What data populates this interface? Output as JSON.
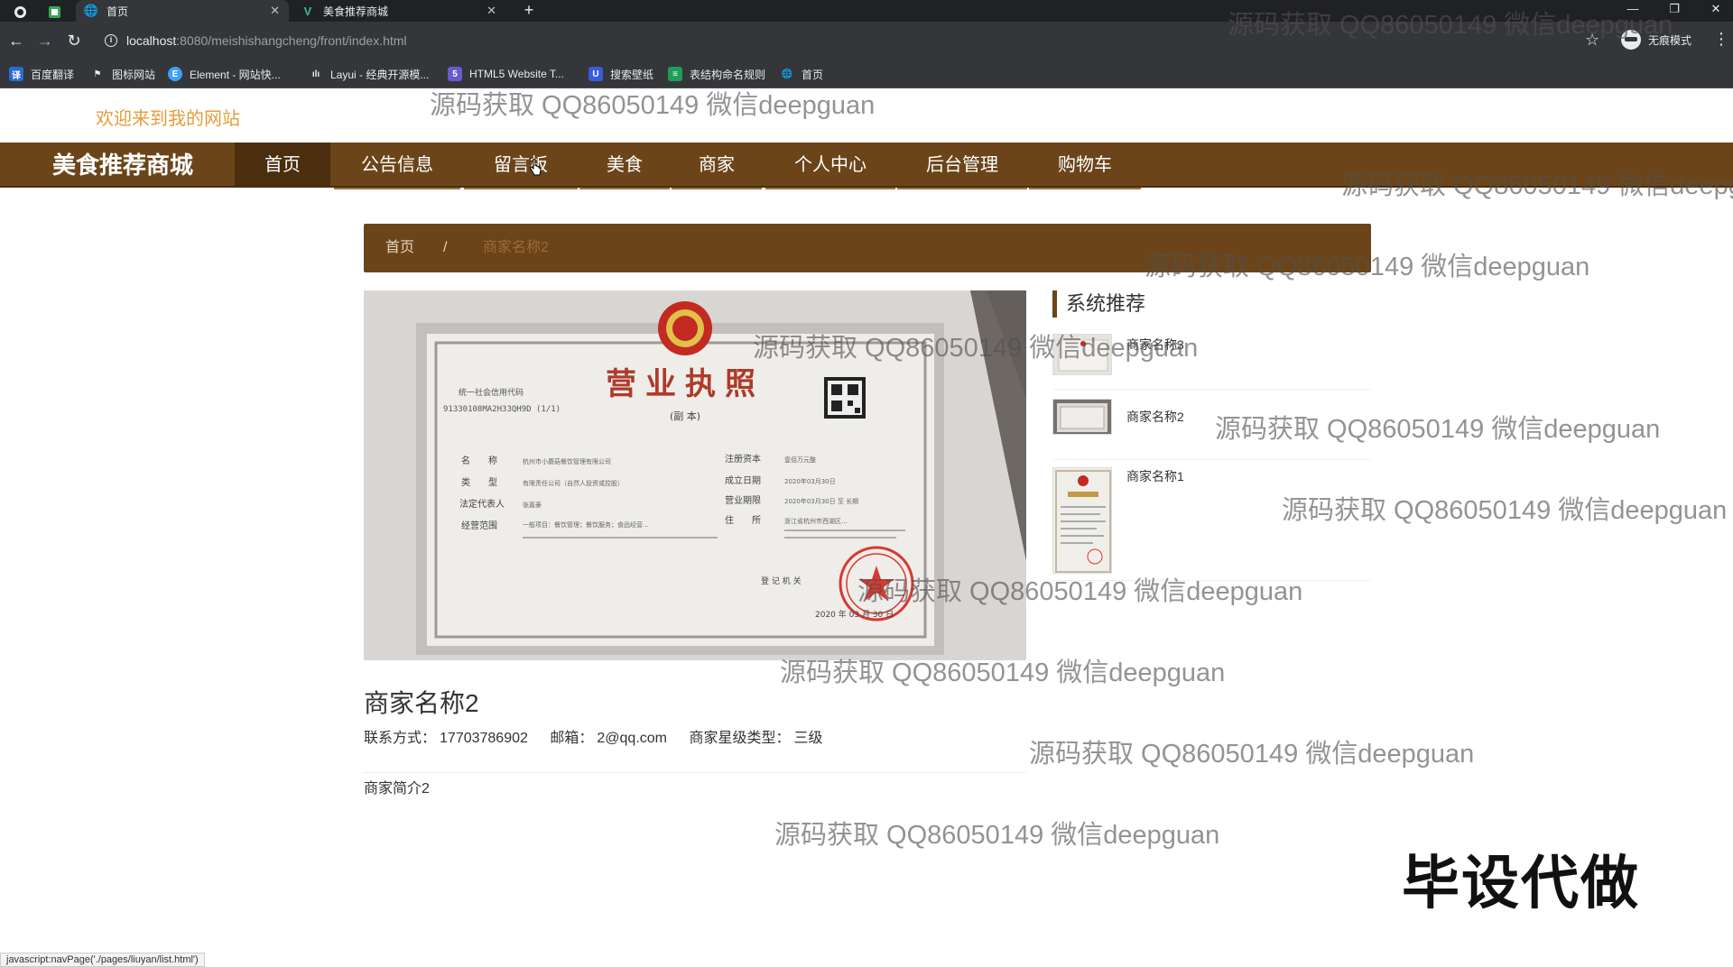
{
  "browser": {
    "tabs": [
      {
        "title": "首页",
        "active": true
      },
      {
        "title": "美食推荐商城",
        "active": false
      }
    ],
    "url_host": "localhost",
    "url_path": ":8080/meishishangcheng/front/index.html",
    "incognito_label": "无痕模式",
    "bookmarks": [
      "百度翻译",
      "图标网站",
      "Element - 网站快...",
      "Layui - 经典开源模...",
      "HTML5 Website T...",
      "搜索壁纸",
      "表结构命名规则",
      "首页"
    ],
    "status_text": "javascript:navPage('./pages/liuyan/list.html')"
  },
  "site": {
    "welcome": "欢迎来到我的网站",
    "brand": "美食推荐商城",
    "nav": [
      "首页",
      "公告信息",
      "留言板",
      "美食",
      "商家",
      "个人中心",
      "后台管理",
      "购物车"
    ],
    "active_nav": "首页"
  },
  "breadcrumb": {
    "home": "首页",
    "separator": "/",
    "current": "商家名称2"
  },
  "license": {
    "title": "营业执照",
    "copy_label": "(副 本)",
    "credit_code_label": "统一社会信用代码",
    "credit_code": "91330108MA2H33QH9D (1/1)",
    "fields_left": [
      {
        "label": "名　　称",
        "value": "杭州市小蘑菇餐饮管理有限公司"
      },
      {
        "label": "类　　型",
        "value": "有限责任公司（自然人投资或控股）"
      },
      {
        "label": "法定代表人",
        "value": "张嘉豪"
      },
      {
        "label": "经营范围",
        "value": "一般项目：餐饮管理；餐饮服务；食品经营..."
      }
    ],
    "fields_right": [
      {
        "label": "注册资本",
        "value": "壹佰万元整"
      },
      {
        "label": "成立日期",
        "value": "2020年03月30日"
      },
      {
        "label": "营业期限",
        "value": "2020年03月30日 至 长期"
      },
      {
        "label": "住　　所",
        "value": "浙江省杭州市西湖区..."
      }
    ],
    "registrar_label": "登 记 机 关",
    "issue_date": "2020 年 03 月 30 日"
  },
  "merchant": {
    "name": "商家名称2",
    "contact_label": "联系方式：",
    "contact": "17703786902",
    "email_label": "邮箱：",
    "email": "2@qq.com",
    "level_label": "商家星级类型：",
    "level": "三级",
    "intro": "商家简介2"
  },
  "sidebar": {
    "title": "系统推荐",
    "items": [
      {
        "name": "商家名称3"
      },
      {
        "name": "商家名称2"
      },
      {
        "name": "商家名称1"
      }
    ]
  },
  "watermark": "源码获取 QQ86050149 微信deepguan",
  "corner_badge": "毕设代做",
  "colors": {
    "nav_brown": "#6b4519",
    "nav_active": "#4a2e0e",
    "welcome_orange": "#e69d3a"
  }
}
